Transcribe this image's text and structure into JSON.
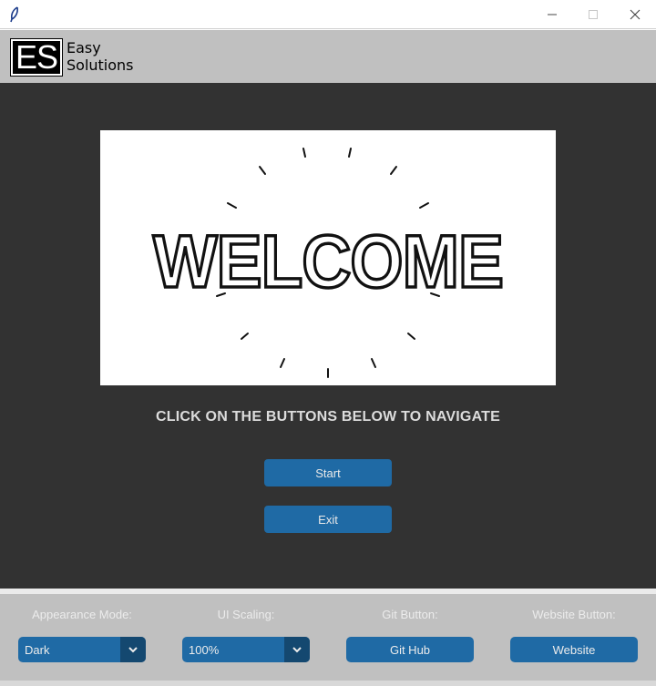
{
  "window": {
    "app_icon": "feather-icon",
    "controls": [
      "minimize-icon",
      "maximize-icon",
      "close-icon"
    ]
  },
  "header": {
    "logo_mark": "ES",
    "logo_line1": "Easy",
    "logo_line2": "Solutions"
  },
  "main": {
    "welcome_image_text": "WELCOME",
    "nav_hint": "CLICK ON THE BUTTONS BELOW TO NAVIGATE",
    "start_label": "Start",
    "exit_label": "Exit"
  },
  "footer": {
    "appearance_label": "Appearance Mode:",
    "appearance_value": "Dark",
    "scaling_label": "UI Scaling:",
    "scaling_value": "100%",
    "git_label": "Git Button:",
    "git_button": "Git Hub",
    "website_label": "Website Button:",
    "website_button": "Website"
  },
  "colors": {
    "accent": "#1f6aa5",
    "accent_dark": "#144870",
    "main_bg": "#323232",
    "header_bg": "#c0c0c0"
  }
}
